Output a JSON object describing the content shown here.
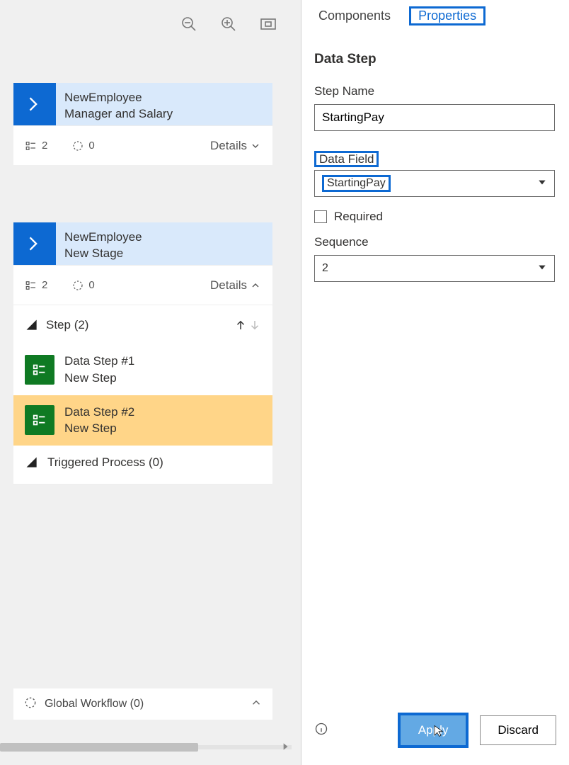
{
  "tabs": {
    "components": "Components",
    "properties": "Properties"
  },
  "panel": {
    "section": "Data Step",
    "stepNameLabel": "Step Name",
    "stepNameValue": "StartingPay",
    "dataFieldLabel": "Data Field",
    "dataFieldValue": "StartingPay",
    "requiredLabel": "Required",
    "sequenceLabel": "Sequence",
    "sequenceValue": "2",
    "applyLabel": "Apply",
    "discardLabel": "Discard"
  },
  "stages": [
    {
      "title1": "NewEmployee",
      "title2": "Manager and Salary",
      "count1": "2",
      "count2": "0",
      "detailsLabel": "Details"
    },
    {
      "title1": "NewEmployee",
      "title2": "New Stage",
      "count1": "2",
      "count2": "0",
      "detailsLabel": "Details",
      "stepHeader": "Step (2)",
      "steps": [
        {
          "label": "Data Step #1",
          "sub": "New Step"
        },
        {
          "label": "Data Step #2",
          "sub": "New Step"
        }
      ],
      "triggered": "Triggered Process (0)"
    }
  ],
  "globalWorkflow": "Global Workflow (0)"
}
